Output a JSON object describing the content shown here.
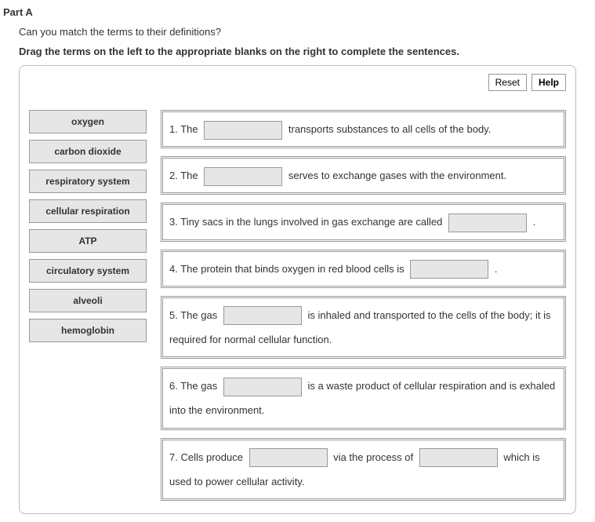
{
  "part_label": "Part A",
  "question": "Can you match the terms to their definitions?",
  "instruction": "Drag the terms on the left to the appropriate blanks on the right to complete the sentences.",
  "toolbar": {
    "reset": "Reset",
    "help": "Help"
  },
  "terms": [
    "oxygen",
    "carbon dioxide",
    "respiratory system",
    "cellular respiration",
    "ATP",
    "circulatory system",
    "alveoli",
    "hemoglobin"
  ],
  "sentences": {
    "s1_a": "1. The",
    "s1_b": "transports substances to all cells of the body.",
    "s2_a": "2. The",
    "s2_b": "serves to exchange gases with the environment.",
    "s3_a": "3. Tiny sacs in the lungs involved in gas exchange are called",
    "s3_b": ".",
    "s4_a": "4. The protein that binds oxygen in red blood cells is",
    "s4_b": ".",
    "s5_a": "5. The gas",
    "s5_b": "is inhaled and transported to the cells of the body; it is required for normal cellular function.",
    "s6_a": "6. The gas",
    "s6_b": "is a waste product of cellular respiration and is exhaled into the environment.",
    "s7_a": "7. Cells produce",
    "s7_b": "via the process of",
    "s7_c": "which is used to power cellular activity."
  }
}
